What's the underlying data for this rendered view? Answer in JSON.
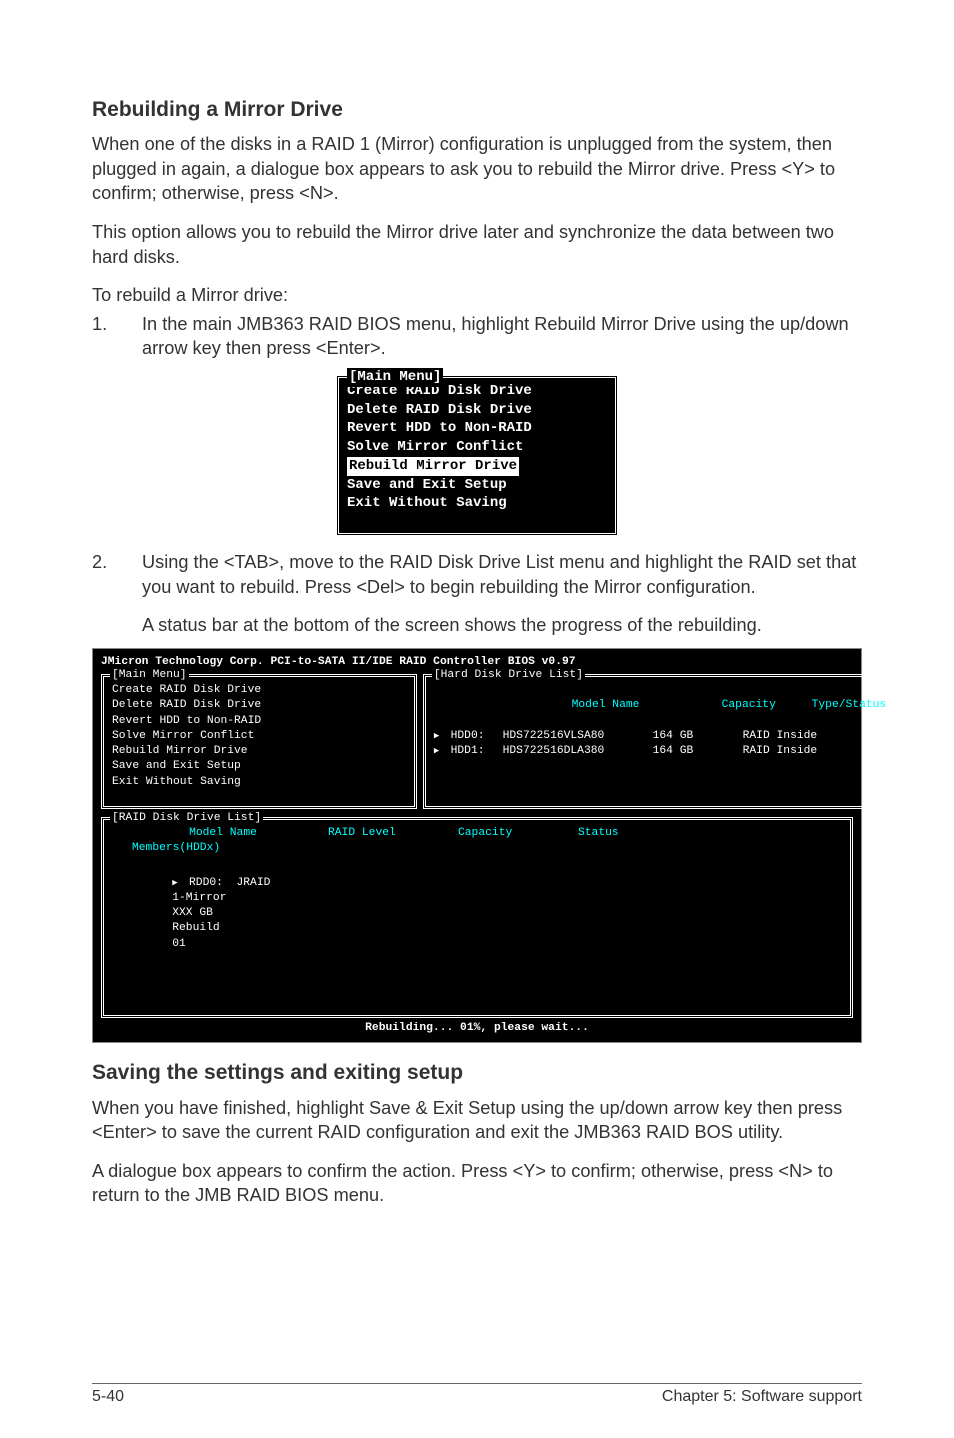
{
  "section1": {
    "heading": "Rebuilding a Mirror Drive",
    "p1": "When one of the disks in a RAID 1 (Mirror) configuration is unplugged from the system, then plugged in again, a dialogue box appears to ask you to rebuild the Mirror drive. Press <Y> to confirm; otherwise, press <N>.",
    "p2": "This option allows you to rebuild the Mirror drive later and synchronize the data between two hard disks.",
    "p3": "To rebuild a Mirror drive:",
    "step1_num": "1.",
    "step1": "In the main JMB363 RAID BIOS menu, highlight Rebuild Mirror Drive using the up/down arrow key then press <Enter>.",
    "step2_num": "2.",
    "step2": "Using the <TAB>, move to the RAID Disk Drive List menu and highlight the RAID set that you want to rebuild. Press <Del> to begin rebuilding the Mirror configuration.",
    "step2b": "A status bar at the bottom of the screen shows the progress of the rebuilding."
  },
  "bios_small": {
    "legend": "[Main Menu]",
    "items": [
      "Create RAID Disk Drive",
      "Delete RAID Disk Drive",
      "Revert HDD to Non-RAID",
      "Solve Mirror Conflict",
      "Rebuild Mirror Drive",
      "Save and Exit Setup",
      "Exit Without Saving"
    ],
    "selected_index": 4
  },
  "bios_large": {
    "title": "JMicron Technology Corp. PCI-to-SATA II/IDE RAID Controller BIOS v0.97",
    "main_legend": "[Main Menu]",
    "main_items": [
      "Create RAID Disk Drive",
      "Delete RAID Disk Drive",
      "Revert HDD to Non-RAID",
      "Solve Mirror Conflict",
      "Rebuild Mirror Drive",
      "Save and Exit Setup",
      "Exit Without Saving"
    ],
    "hdd_legend": "[Hard Disk Drive List]",
    "hdd_head": {
      "model": "Model Name",
      "capacity": "Capacity",
      "type": "Type/Status"
    },
    "hdd_rows": [
      {
        "slot": "HDD0:",
        "model": "HDS722516VLSA80",
        "capacity": "164 GB",
        "type": "RAID Inside"
      },
      {
        "slot": "HDD1:",
        "model": "HDS722516DLA380",
        "capacity": "164 GB",
        "type": "RAID Inside"
      }
    ],
    "raid_legend": "[RAID Disk Drive List]",
    "raid_head": {
      "model": "Model Name",
      "level": "RAID Level",
      "capacity": "Capacity",
      "status": "Status"
    },
    "raid_members": "Members(HDDx)",
    "raid_row": {
      "slot": "RDD0:",
      "name": "JRAID",
      "level": "1-Mirror",
      "capacity": "XXX GB",
      "status": "Rebuild",
      "extra": "01"
    },
    "statusbar": "Rebuilding... 01%, please wait..."
  },
  "section2": {
    "heading": "Saving the settings and exiting setup",
    "p1": "When you have finished, highlight Save & Exit Setup using the up/down arrow key then press <Enter> to save the current RAID configuration and exit the JMB363 RAID BOS utility.",
    "p2": "A dialogue box appears to confirm the action. Press <Y> to confirm; otherwise, press <N> to return to the JMB RAID BIOS menu."
  },
  "footer": {
    "left": "5-40",
    "right": "Chapter 5: Software support"
  }
}
